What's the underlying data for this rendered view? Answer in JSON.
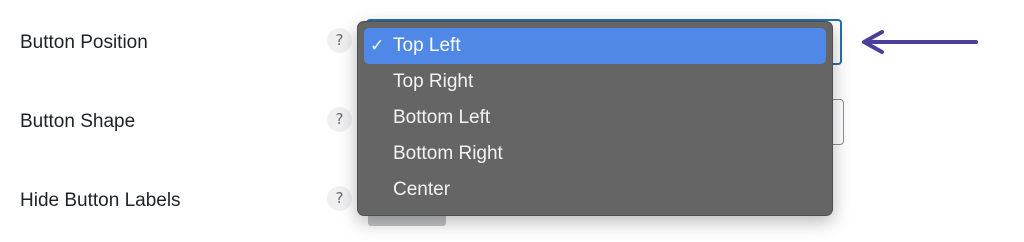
{
  "settings": {
    "rows": [
      {
        "label": "Button Position",
        "help": "?"
      },
      {
        "label": "Button Shape",
        "help": "?"
      },
      {
        "label": "Hide Button Labels",
        "help": "?"
      }
    ]
  },
  "dropdown": {
    "selected_mark": "✓",
    "options": [
      {
        "label": "Top Left",
        "selected": true
      },
      {
        "label": "Top Right",
        "selected": false
      },
      {
        "label": "Bottom Left",
        "selected": false
      },
      {
        "label": "Bottom Right",
        "selected": false
      },
      {
        "label": "Center",
        "selected": false
      }
    ]
  },
  "icons": {
    "help": "question-mark-icon",
    "check": "checkmark-icon",
    "annotation": "left-arrow-icon"
  },
  "colors": {
    "selected_option_bg": "#4f88e6",
    "menu_bg": "#656565",
    "focus_border": "#2271b1",
    "arrow": "#4a3f9c"
  }
}
